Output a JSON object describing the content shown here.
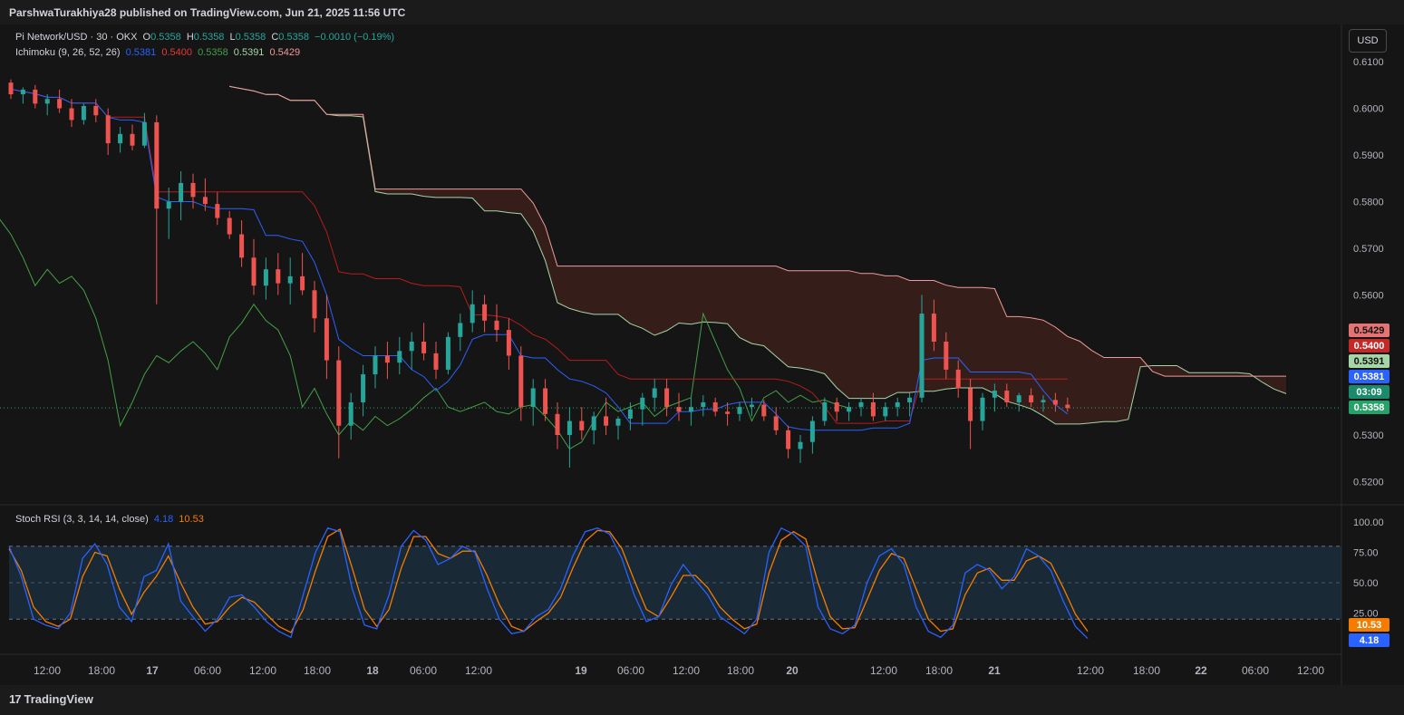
{
  "header": {
    "publisher": "ParshwaTurakhiya28 published on TradingView.com, Jun 21, 2025 11:56 UTC"
  },
  "symbol_legend": {
    "symbol": "Pi Network/USD · 30 · OKX",
    "o_label": "O",
    "o": "0.5358",
    "h_label": "H",
    "h": "0.5358",
    "l_label": "L",
    "l": "0.5358",
    "c_label": "C",
    "c": "0.5358",
    "change": "−0.0010 (−0.19%)"
  },
  "ichimoku_legend": {
    "name": "Ichimoku (9, 26, 52, 26)",
    "v1": "0.5381",
    "v2": "0.5400",
    "v3": "0.5358",
    "v4": "0.5391",
    "v5": "0.5429"
  },
  "stoch_legend": {
    "name": "Stoch RSI (3, 3, 14, 14, close)",
    "k": "4.18",
    "d": "10.53"
  },
  "currency_button": "USD",
  "price_labels": [
    {
      "text": "0.5429",
      "color": "#e57373"
    },
    {
      "text": "0.5400",
      "color": "#c62828"
    },
    {
      "text": "0.5391",
      "color": "#a5d6a7"
    },
    {
      "text": "0.5381",
      "color": "#2962ff"
    },
    {
      "text": "03:09",
      "color": "#1b8a6b"
    },
    {
      "text": "0.5358",
      "color": "#26a269"
    }
  ],
  "rsi_labels": [
    {
      "text": "10.53",
      "color": "#f57c00"
    },
    {
      "text": "4.18",
      "color": "#2962ff"
    }
  ],
  "footer": {
    "brand": "TradingView",
    "brand_mark": "17"
  },
  "colors": {
    "up": "#26a69a",
    "down": "#ef5350",
    "tenkan": "#2962ff",
    "kijun": "#b71c1c",
    "chikou": "#43a047",
    "spanA": "#a5d6a7",
    "spanB": "#ef9a9a",
    "stoch_k": "#2962ff",
    "stoch_d": "#f57c00"
  },
  "chart_data": [
    {
      "type": "candlestick",
      "title": "Pi Network/USD · 30 · OKX",
      "y_ticks": [
        "0.6100",
        "0.6000",
        "0.5900",
        "0.5800",
        "0.5700",
        "0.5600",
        "0.5300",
        "0.5200"
      ],
      "ylim": [
        0.5175,
        0.6105
      ],
      "x_ticks": [
        "12:00",
        "18:00",
        "17",
        "06:00",
        "12:00",
        "18:00",
        "18",
        "06:00",
        "12:00",
        "19",
        "06:00",
        "12:00",
        "18:00",
        "20",
        "12:00",
        "18:00",
        "21",
        "12:00",
        "18:00",
        "22",
        "06:00",
        "12:00"
      ],
      "last_price": 0.5358,
      "candles": [
        [
          0.6055,
          0.6062,
          0.602,
          0.603
        ],
        [
          0.603,
          0.6045,
          0.601,
          0.604
        ],
        [
          0.604,
          0.605,
          0.6,
          0.601
        ],
        [
          0.601,
          0.603,
          0.5985,
          0.602
        ],
        [
          0.602,
          0.604,
          0.599,
          0.6
        ],
        [
          0.6,
          0.602,
          0.596,
          0.5975
        ],
        [
          0.5975,
          0.601,
          0.5965,
          0.6005
        ],
        [
          0.6005,
          0.602,
          0.597,
          0.5985
        ],
        [
          0.5985,
          0.6,
          0.59,
          0.5925
        ],
        [
          0.5925,
          0.596,
          0.5905,
          0.5945
        ],
        [
          0.5945,
          0.5965,
          0.591,
          0.592
        ],
        [
          0.592,
          0.599,
          0.5915,
          0.597
        ],
        [
          0.597,
          0.5985,
          0.558,
          0.5785
        ],
        [
          0.5785,
          0.583,
          0.572,
          0.58
        ],
        [
          0.58,
          0.5865,
          0.576,
          0.584
        ],
        [
          0.584,
          0.586,
          0.5785,
          0.581
        ],
        [
          0.581,
          0.585,
          0.578,
          0.5795
        ],
        [
          0.5795,
          0.582,
          0.575,
          0.5765
        ],
        [
          0.5765,
          0.578,
          0.572,
          0.573
        ],
        [
          0.573,
          0.576,
          0.566,
          0.568
        ],
        [
          0.568,
          0.572,
          0.56,
          0.562
        ],
        [
          0.562,
          0.568,
          0.559,
          0.5655
        ],
        [
          0.5655,
          0.569,
          0.56,
          0.5625
        ],
        [
          0.5625,
          0.568,
          0.558,
          0.564
        ],
        [
          0.564,
          0.569,
          0.56,
          0.561
        ],
        [
          0.561,
          0.563,
          0.552,
          0.555
        ],
        [
          0.555,
          0.56,
          0.542,
          0.546
        ],
        [
          0.546,
          0.549,
          0.525,
          0.532
        ],
        [
          0.532,
          0.539,
          0.529,
          0.537
        ],
        [
          0.537,
          0.545,
          0.534,
          0.543
        ],
        [
          0.543,
          0.549,
          0.54,
          0.547
        ],
        [
          0.547,
          0.55,
          0.542,
          0.5455
        ],
        [
          0.5455,
          0.551,
          0.543,
          0.548
        ],
        [
          0.548,
          0.552,
          0.544,
          0.55
        ],
        [
          0.55,
          0.554,
          0.546,
          0.5475
        ],
        [
          0.5475,
          0.55,
          0.542,
          0.544
        ],
        [
          0.544,
          0.552,
          0.543,
          0.551
        ],
        [
          0.551,
          0.556,
          0.548,
          0.554
        ],
        [
          0.554,
          0.561,
          0.552,
          0.558
        ],
        [
          0.558,
          0.56,
          0.552,
          0.5545
        ],
        [
          0.5545,
          0.558,
          0.55,
          0.5525
        ],
        [
          0.5525,
          0.555,
          0.544,
          0.547
        ],
        [
          0.547,
          0.549,
          0.533,
          0.536
        ],
        [
          0.536,
          0.542,
          0.532,
          0.54
        ],
        [
          0.54,
          0.542,
          0.533,
          0.5345
        ],
        [
          0.5345,
          0.537,
          0.527,
          0.53
        ],
        [
          0.53,
          0.536,
          0.523,
          0.533
        ],
        [
          0.533,
          0.536,
          0.529,
          0.531
        ],
        [
          0.531,
          0.535,
          0.528,
          0.534
        ],
        [
          0.534,
          0.538,
          0.53,
          0.532
        ],
        [
          0.532,
          0.534,
          0.529,
          0.5335
        ],
        [
          0.5335,
          0.537,
          0.531,
          0.5355
        ],
        [
          0.5355,
          0.539,
          0.532,
          0.538
        ],
        [
          0.538,
          0.542,
          0.535,
          0.54
        ],
        [
          0.54,
          0.542,
          0.534,
          0.536
        ],
        [
          0.536,
          0.539,
          0.533,
          0.535
        ],
        [
          0.535,
          0.538,
          0.532,
          0.536
        ],
        [
          0.536,
          0.5385,
          0.534,
          0.537
        ],
        [
          0.537,
          0.538,
          0.534,
          0.535
        ],
        [
          0.535,
          0.537,
          0.532,
          0.5345
        ],
        [
          0.5345,
          0.537,
          0.533,
          0.536
        ],
        [
          0.536,
          0.538,
          0.534,
          0.5365
        ],
        [
          0.5365,
          0.5375,
          0.533,
          0.534
        ],
        [
          0.534,
          0.536,
          0.53,
          0.531
        ],
        [
          0.531,
          0.532,
          0.525,
          0.527
        ],
        [
          0.527,
          0.53,
          0.524,
          0.5285
        ],
        [
          0.5285,
          0.534,
          0.526,
          0.533
        ],
        [
          0.533,
          0.538,
          0.532,
          0.537
        ],
        [
          0.537,
          0.538,
          0.533,
          0.535
        ],
        [
          0.535,
          0.537,
          0.533,
          0.536
        ],
        [
          0.536,
          0.538,
          0.534,
          0.537
        ],
        [
          0.537,
          0.539,
          0.533,
          0.534
        ],
        [
          0.534,
          0.537,
          0.533,
          0.536
        ],
        [
          0.536,
          0.538,
          0.534,
          0.537
        ],
        [
          0.537,
          0.539,
          0.534,
          0.538
        ],
        [
          0.538,
          0.56,
          0.537,
          0.556
        ],
        [
          0.556,
          0.559,
          0.548,
          0.55
        ],
        [
          0.55,
          0.552,
          0.542,
          0.544
        ],
        [
          0.544,
          0.546,
          0.538,
          0.54
        ],
        [
          0.54,
          0.542,
          0.527,
          0.533
        ],
        [
          0.533,
          0.539,
          0.531,
          0.538
        ],
        [
          0.538,
          0.541,
          0.535,
          0.5395
        ],
        [
          0.5395,
          0.541,
          0.536,
          0.537
        ],
        [
          0.537,
          0.539,
          0.535,
          0.5385
        ],
        [
          0.5385,
          0.54,
          0.536,
          0.537
        ],
        [
          0.537,
          0.5385,
          0.535,
          0.5375
        ],
        [
          0.5375,
          0.539,
          0.535,
          0.5365
        ],
        [
          0.5365,
          0.538,
          0.535,
          0.5358
        ]
      ]
    },
    {
      "type": "line",
      "title": "Stoch RSI (3, 3, 14, 14, close)",
      "y_ticks": [
        "100.00",
        "75.00",
        "50.00",
        "25.00"
      ],
      "ylim": [
        0,
        100
      ],
      "bands": [
        20,
        80
      ],
      "series": [
        {
          "name": "K",
          "values": [
            80,
            55,
            20,
            15,
            12,
            25,
            70,
            82,
            65,
            30,
            18,
            55,
            60,
            82,
            35,
            22,
            10,
            20,
            38,
            40,
            30,
            18,
            10,
            5,
            40,
            75,
            95,
            92,
            45,
            15,
            12,
            40,
            80,
            93,
            85,
            65,
            70,
            80,
            75,
            45,
            20,
            8,
            10,
            22,
            28,
            45,
            72,
            92,
            95,
            90,
            70,
            40,
            18,
            22,
            48,
            65,
            52,
            40,
            22,
            15,
            8,
            20,
            75,
            95,
            90,
            80,
            30,
            12,
            8,
            15,
            50,
            72,
            78,
            65,
            30,
            10,
            5,
            15,
            58,
            65,
            60,
            45,
            55,
            78,
            72,
            60,
            35,
            14,
            4
          ]
        },
        {
          "name": "D",
          "values": [
            78,
            60,
            30,
            18,
            14,
            20,
            55,
            75,
            72,
            45,
            24,
            42,
            55,
            72,
            50,
            30,
            16,
            18,
            30,
            38,
            34,
            24,
            14,
            9,
            28,
            60,
            88,
            94,
            62,
            28,
            14,
            28,
            62,
            88,
            88,
            74,
            70,
            76,
            76,
            56,
            32,
            14,
            10,
            18,
            25,
            38,
            62,
            84,
            93,
            92,
            78,
            52,
            28,
            22,
            38,
            56,
            56,
            46,
            30,
            20,
            12,
            16,
            58,
            85,
            92,
            86,
            50,
            22,
            12,
            13,
            36,
            60,
            74,
            70,
            45,
            20,
            10,
            12,
            40,
            58,
            62,
            52,
            52,
            68,
            72,
            66,
            46,
            24,
            10
          ]
        }
      ]
    }
  ]
}
